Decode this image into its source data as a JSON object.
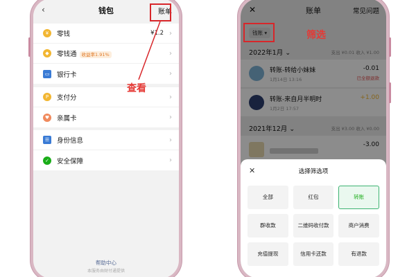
{
  "left_screen": {
    "back_icon": "chevron-left-icon",
    "title": "钱包",
    "bill_link": "账单",
    "groups": [
      [
        {
          "icon": "coin-icon",
          "color": "#f2b632",
          "label": "零钱",
          "value": "¥1.2",
          "badge": ""
        },
        {
          "icon": "diamond-icon",
          "color": "#f2b632",
          "label": "零钱通",
          "value": "",
          "badge": "收益率1.91%"
        },
        {
          "icon": "card-icon",
          "color": "#3a7bd5",
          "label": "银行卡",
          "value": "",
          "badge": ""
        }
      ],
      [
        {
          "icon": "score-icon",
          "color": "#f2b632",
          "label": "支付分",
          "value": "",
          "badge": ""
        },
        {
          "icon": "family-card-icon",
          "color": "#f08a5d",
          "label": "亲属卡",
          "value": "",
          "badge": ""
        }
      ],
      [
        {
          "icon": "id-icon",
          "color": "#3a7bd5",
          "label": "身份信息",
          "value": "",
          "badge": ""
        },
        {
          "icon": "shield-icon",
          "color": "#1aad19",
          "label": "安全保障",
          "value": "",
          "badge": ""
        }
      ]
    ],
    "help_center": "帮助中心",
    "help_sub": "本服务由财付通提供",
    "annotation": "查看"
  },
  "right_screen": {
    "close_icon": "close-icon",
    "title": "账单",
    "faq": "常见问题",
    "filter_chip": "钱账 ▾",
    "annotation": "筛选",
    "months": [
      {
        "label": "2022年1月 ⌄",
        "summary": "支出 ¥0.01   收入 ¥1.00"
      },
      {
        "label": "2021年12月 ⌄",
        "summary": "支出 ¥3.00   收入 ¥0.00"
      }
    ],
    "transactions": [
      {
        "name": "转账-转给小妹妹",
        "time": "1月14日 13:16",
        "amount": "-0.01",
        "status": "已全额退款",
        "amount_color": "#111111"
      },
      {
        "name": "转账-来自月半明时",
        "time": "1月2日 17:57",
        "amount": "+1.00",
        "status": "",
        "amount_color": "#f2b632"
      },
      {
        "name": "",
        "time": "",
        "amount": "-3.00",
        "status": "",
        "amount_color": "#111111"
      }
    ],
    "sheet": {
      "title": "选择筛选项",
      "options": [
        "全部",
        "红包",
        "转账",
        "群收款",
        "二维码收付款",
        "商户消费",
        "充值提现",
        "信用卡还款",
        "有退款"
      ],
      "selected_index": 2
    }
  },
  "colors": {
    "annotation_red": "#d8262a",
    "wechat_green": "#1aad19",
    "phone_frame": "#d9b7c3"
  }
}
